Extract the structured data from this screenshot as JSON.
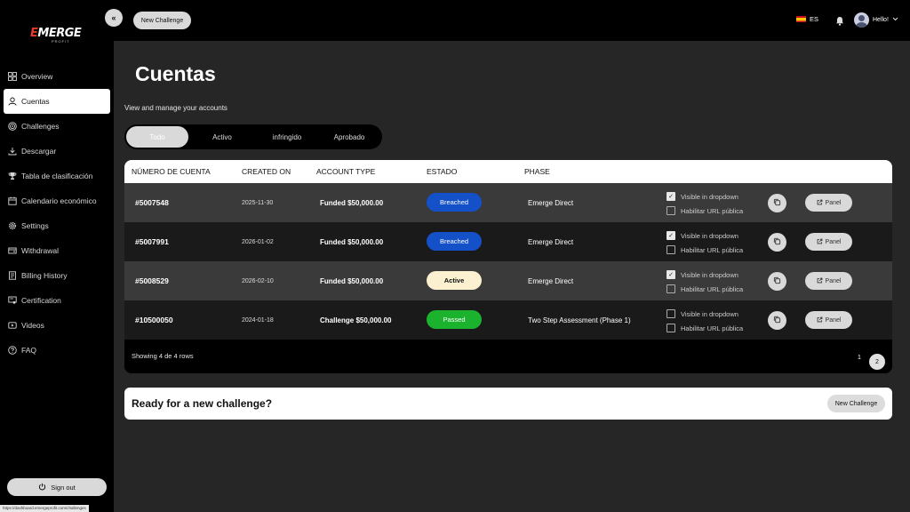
{
  "brand": {
    "logo_text": "EMERGE",
    "logo_sub": "PROFIT",
    "accent": "#e53a2b"
  },
  "sidebar": {
    "items": [
      {
        "label": "Overview",
        "icon": "grid-icon"
      },
      {
        "label": "Cuentas",
        "icon": "user-icon",
        "active": true
      },
      {
        "label": "Challenges",
        "icon": "target-icon"
      },
      {
        "label": "Descargar",
        "icon": "download-icon"
      },
      {
        "label": "Tabla de clasificación",
        "icon": "trophy-icon"
      },
      {
        "label": "Calendario económico",
        "icon": "calendar-icon"
      },
      {
        "label": "Settings",
        "icon": "gear-icon"
      },
      {
        "label": "Withdrawal",
        "icon": "withdrawal-icon"
      },
      {
        "label": "Billing History",
        "icon": "billing-icon"
      },
      {
        "label": "Certification",
        "icon": "certificate-icon"
      },
      {
        "label": "Videos",
        "icon": "video-icon"
      },
      {
        "label": "FAQ",
        "icon": "help-icon"
      }
    ],
    "signout_label": "Sign out"
  },
  "status_url": "https://dashboard.emergeprofit.com/challenges",
  "topbar": {
    "new_challenge_label": "New Challenge",
    "language": "ES",
    "user_greeting": "Hello!"
  },
  "main": {
    "title": "Cuentas",
    "subtitle": "View and manage your accounts",
    "tabs": [
      {
        "label": "Todo",
        "active": true
      },
      {
        "label": "Activo"
      },
      {
        "label": "infringido"
      },
      {
        "label": "Aprobado"
      }
    ],
    "table": {
      "headers": [
        "NÚMERO DE CUENTA",
        "CREATED ON",
        "ACCOUNT TYPE",
        "ESTADO",
        "PHASE"
      ],
      "rows": [
        {
          "account": "#5007548",
          "created": "2025-11-30",
          "type": "Funded $50,000.00",
          "status": "Breached",
          "status_kind": "breached",
          "phase": "Emerge Direct",
          "visible_dropdown": true,
          "public_url": false
        },
        {
          "account": "#5007991",
          "created": "2026-01-02",
          "type": "Funded $50,000.00",
          "status": "Breached",
          "status_kind": "breached",
          "phase": "Emerge Direct",
          "visible_dropdown": true,
          "public_url": false
        },
        {
          "account": "#5008529",
          "created": "2026-02-10",
          "type": "Funded $50,000.00",
          "status": "Active",
          "status_kind": "active",
          "phase": "Emerge Direct",
          "visible_dropdown": true,
          "public_url": false
        },
        {
          "account": "#10500050",
          "created": "2024-01-18",
          "type": "Challenge $50,000.00",
          "status": "Passed",
          "status_kind": "passed",
          "phase": "Two Step Assessment (Phase 1)",
          "visible_dropdown": false,
          "public_url": false
        }
      ],
      "visible_dropdown_label": "Visible in dropdown",
      "public_url_label": "Habilitar URL pública",
      "panel_label": "Panel",
      "footer_text": "Showing 4 de 4 rows",
      "pages": [
        "1",
        "2"
      ],
      "current_page": "2"
    },
    "cta": {
      "text": "Ready for a new challenge?",
      "button_label": "New Challenge"
    }
  },
  "colors": {
    "breached": "#1450c8",
    "active": "#fbf0cf",
    "passed": "#1bb32e"
  }
}
